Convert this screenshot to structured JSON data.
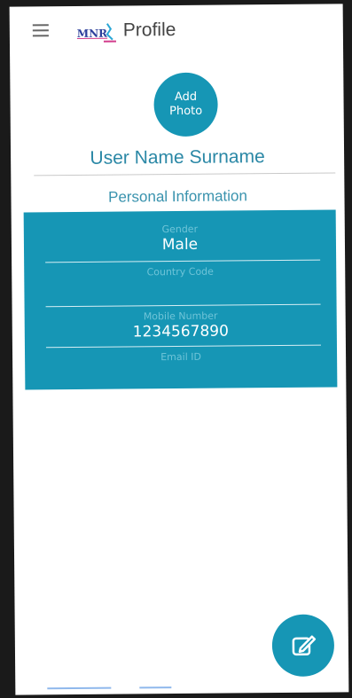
{
  "header": {
    "logo_text": "MNR",
    "title": "Profile"
  },
  "profile": {
    "avatar_label_line1": "Add",
    "avatar_label_line2": "Photo",
    "user_name": "User Name Surname"
  },
  "personal_info": {
    "section_title": "Personal Information",
    "fields": [
      {
        "label": "Gender",
        "value": "Male"
      },
      {
        "label": "Country Code",
        "value": ""
      },
      {
        "label": "Mobile Number",
        "value": "1234567890"
      },
      {
        "label": "Email ID",
        "value": ""
      }
    ]
  },
  "colors": {
    "accent": "#1696b5",
    "title_text": "#2b88a6",
    "field_label": "#6fc4d8"
  },
  "icons": {
    "menu": "hamburger-icon",
    "fab": "edit-icon"
  }
}
